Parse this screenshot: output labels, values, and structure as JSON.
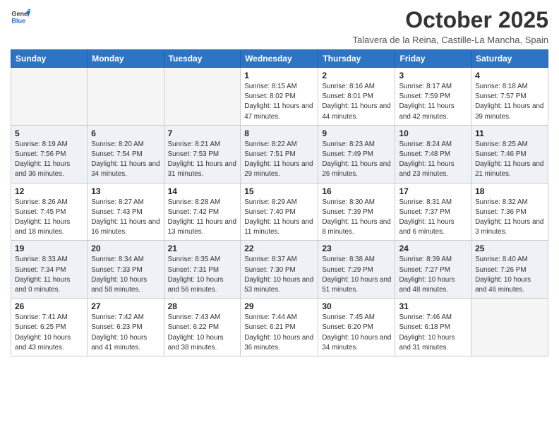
{
  "logo": {
    "line1": "General",
    "line2": "Blue"
  },
  "title": "October 2025",
  "subtitle": "Talavera de la Reina, Castille-La Mancha, Spain",
  "days_of_week": [
    "Sunday",
    "Monday",
    "Tuesday",
    "Wednesday",
    "Thursday",
    "Friday",
    "Saturday"
  ],
  "weeks": [
    [
      {
        "day": "",
        "info": ""
      },
      {
        "day": "",
        "info": ""
      },
      {
        "day": "",
        "info": ""
      },
      {
        "day": "1",
        "info": "Sunrise: 8:15 AM\nSunset: 8:02 PM\nDaylight: 11 hours and 47 minutes."
      },
      {
        "day": "2",
        "info": "Sunrise: 8:16 AM\nSunset: 8:01 PM\nDaylight: 11 hours and 44 minutes."
      },
      {
        "day": "3",
        "info": "Sunrise: 8:17 AM\nSunset: 7:59 PM\nDaylight: 11 hours and 42 minutes."
      },
      {
        "day": "4",
        "info": "Sunrise: 8:18 AM\nSunset: 7:57 PM\nDaylight: 11 hours and 39 minutes."
      }
    ],
    [
      {
        "day": "5",
        "info": "Sunrise: 8:19 AM\nSunset: 7:56 PM\nDaylight: 11 hours and 36 minutes."
      },
      {
        "day": "6",
        "info": "Sunrise: 8:20 AM\nSunset: 7:54 PM\nDaylight: 11 hours and 34 minutes."
      },
      {
        "day": "7",
        "info": "Sunrise: 8:21 AM\nSunset: 7:53 PM\nDaylight: 11 hours and 31 minutes."
      },
      {
        "day": "8",
        "info": "Sunrise: 8:22 AM\nSunset: 7:51 PM\nDaylight: 11 hours and 29 minutes."
      },
      {
        "day": "9",
        "info": "Sunrise: 8:23 AM\nSunset: 7:49 PM\nDaylight: 11 hours and 26 minutes."
      },
      {
        "day": "10",
        "info": "Sunrise: 8:24 AM\nSunset: 7:48 PM\nDaylight: 11 hours and 23 minutes."
      },
      {
        "day": "11",
        "info": "Sunrise: 8:25 AM\nSunset: 7:46 PM\nDaylight: 11 hours and 21 minutes."
      }
    ],
    [
      {
        "day": "12",
        "info": "Sunrise: 8:26 AM\nSunset: 7:45 PM\nDaylight: 11 hours and 18 minutes."
      },
      {
        "day": "13",
        "info": "Sunrise: 8:27 AM\nSunset: 7:43 PM\nDaylight: 11 hours and 16 minutes."
      },
      {
        "day": "14",
        "info": "Sunrise: 8:28 AM\nSunset: 7:42 PM\nDaylight: 11 hours and 13 minutes."
      },
      {
        "day": "15",
        "info": "Sunrise: 8:29 AM\nSunset: 7:40 PM\nDaylight: 11 hours and 11 minutes."
      },
      {
        "day": "16",
        "info": "Sunrise: 8:30 AM\nSunset: 7:39 PM\nDaylight: 11 hours and 8 minutes."
      },
      {
        "day": "17",
        "info": "Sunrise: 8:31 AM\nSunset: 7:37 PM\nDaylight: 11 hours and 6 minutes."
      },
      {
        "day": "18",
        "info": "Sunrise: 8:32 AM\nSunset: 7:36 PM\nDaylight: 11 hours and 3 minutes."
      }
    ],
    [
      {
        "day": "19",
        "info": "Sunrise: 8:33 AM\nSunset: 7:34 PM\nDaylight: 11 hours and 0 minutes."
      },
      {
        "day": "20",
        "info": "Sunrise: 8:34 AM\nSunset: 7:33 PM\nDaylight: 10 hours and 58 minutes."
      },
      {
        "day": "21",
        "info": "Sunrise: 8:35 AM\nSunset: 7:31 PM\nDaylight: 10 hours and 56 minutes."
      },
      {
        "day": "22",
        "info": "Sunrise: 8:37 AM\nSunset: 7:30 PM\nDaylight: 10 hours and 53 minutes."
      },
      {
        "day": "23",
        "info": "Sunrise: 8:38 AM\nSunset: 7:29 PM\nDaylight: 10 hours and 51 minutes."
      },
      {
        "day": "24",
        "info": "Sunrise: 8:39 AM\nSunset: 7:27 PM\nDaylight: 10 hours and 48 minutes."
      },
      {
        "day": "25",
        "info": "Sunrise: 8:40 AM\nSunset: 7:26 PM\nDaylight: 10 hours and 46 minutes."
      }
    ],
    [
      {
        "day": "26",
        "info": "Sunrise: 7:41 AM\nSunset: 6:25 PM\nDaylight: 10 hours and 43 minutes."
      },
      {
        "day": "27",
        "info": "Sunrise: 7:42 AM\nSunset: 6:23 PM\nDaylight: 10 hours and 41 minutes."
      },
      {
        "day": "28",
        "info": "Sunrise: 7:43 AM\nSunset: 6:22 PM\nDaylight: 10 hours and 38 minutes."
      },
      {
        "day": "29",
        "info": "Sunrise: 7:44 AM\nSunset: 6:21 PM\nDaylight: 10 hours and 36 minutes."
      },
      {
        "day": "30",
        "info": "Sunrise: 7:45 AM\nSunset: 6:20 PM\nDaylight: 10 hours and 34 minutes."
      },
      {
        "day": "31",
        "info": "Sunrise: 7:46 AM\nSunset: 6:18 PM\nDaylight: 10 hours and 31 minutes."
      },
      {
        "day": "",
        "info": ""
      }
    ]
  ]
}
